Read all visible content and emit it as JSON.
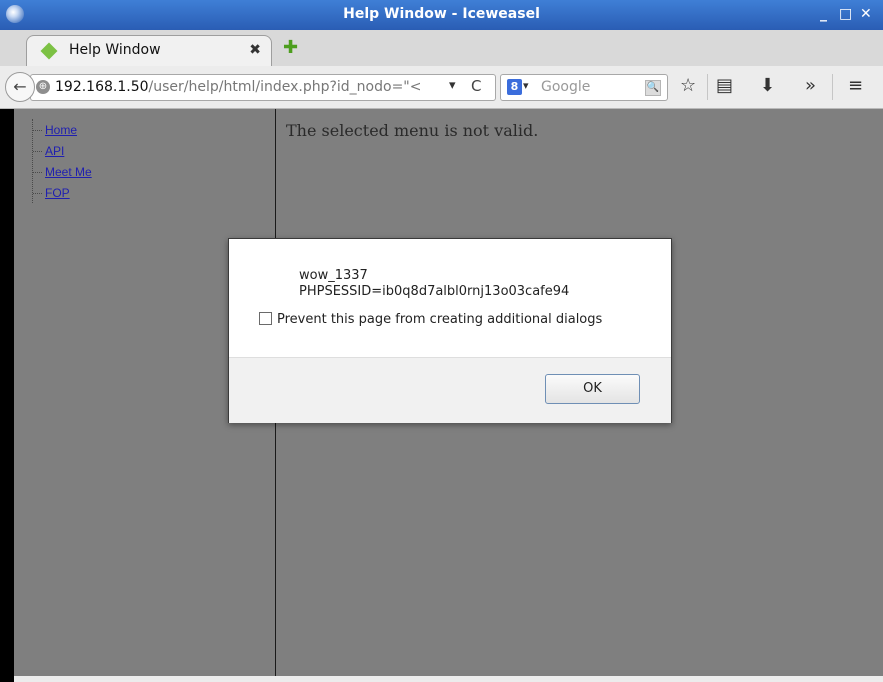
{
  "window": {
    "title": "Help Window - Iceweasel",
    "controls": [
      "_",
      "□",
      "✕"
    ]
  },
  "tab": {
    "label": "Help Window",
    "close": "✖",
    "new_tab": "✚"
  },
  "nav": {
    "back": "←",
    "url_host": "192.168.1.50",
    "url_path": "/user/help/html/index.php?id_nodo=\"<",
    "dropdown": "▾",
    "reload": "C",
    "search_engine_logo": "8",
    "search_dropdown": "▾",
    "search_placeholder": "Google",
    "search_button": "🔍",
    "icons": {
      "bookmark": "☆",
      "reading_list": "▤",
      "download": "⬇",
      "overflow": "»",
      "menu": "≡"
    }
  },
  "sidebar": {
    "items": [
      {
        "label": "Home"
      },
      {
        "label": "API"
      },
      {
        "label": "Meet Me"
      },
      {
        "label": "FOP"
      }
    ]
  },
  "main": {
    "message": "The selected menu is not valid."
  },
  "dialog": {
    "line1": "wow_1337",
    "line2": "PHPSESSID=ib0q8d7albl0rnj13o03cafe94",
    "checkbox_label": "Prevent this page from creating additional dialogs",
    "ok_label": "OK"
  },
  "colors": {
    "titlebar": "#2f6cc7",
    "content_bg": "#7f7f7f",
    "link": "#1f1fb0"
  }
}
